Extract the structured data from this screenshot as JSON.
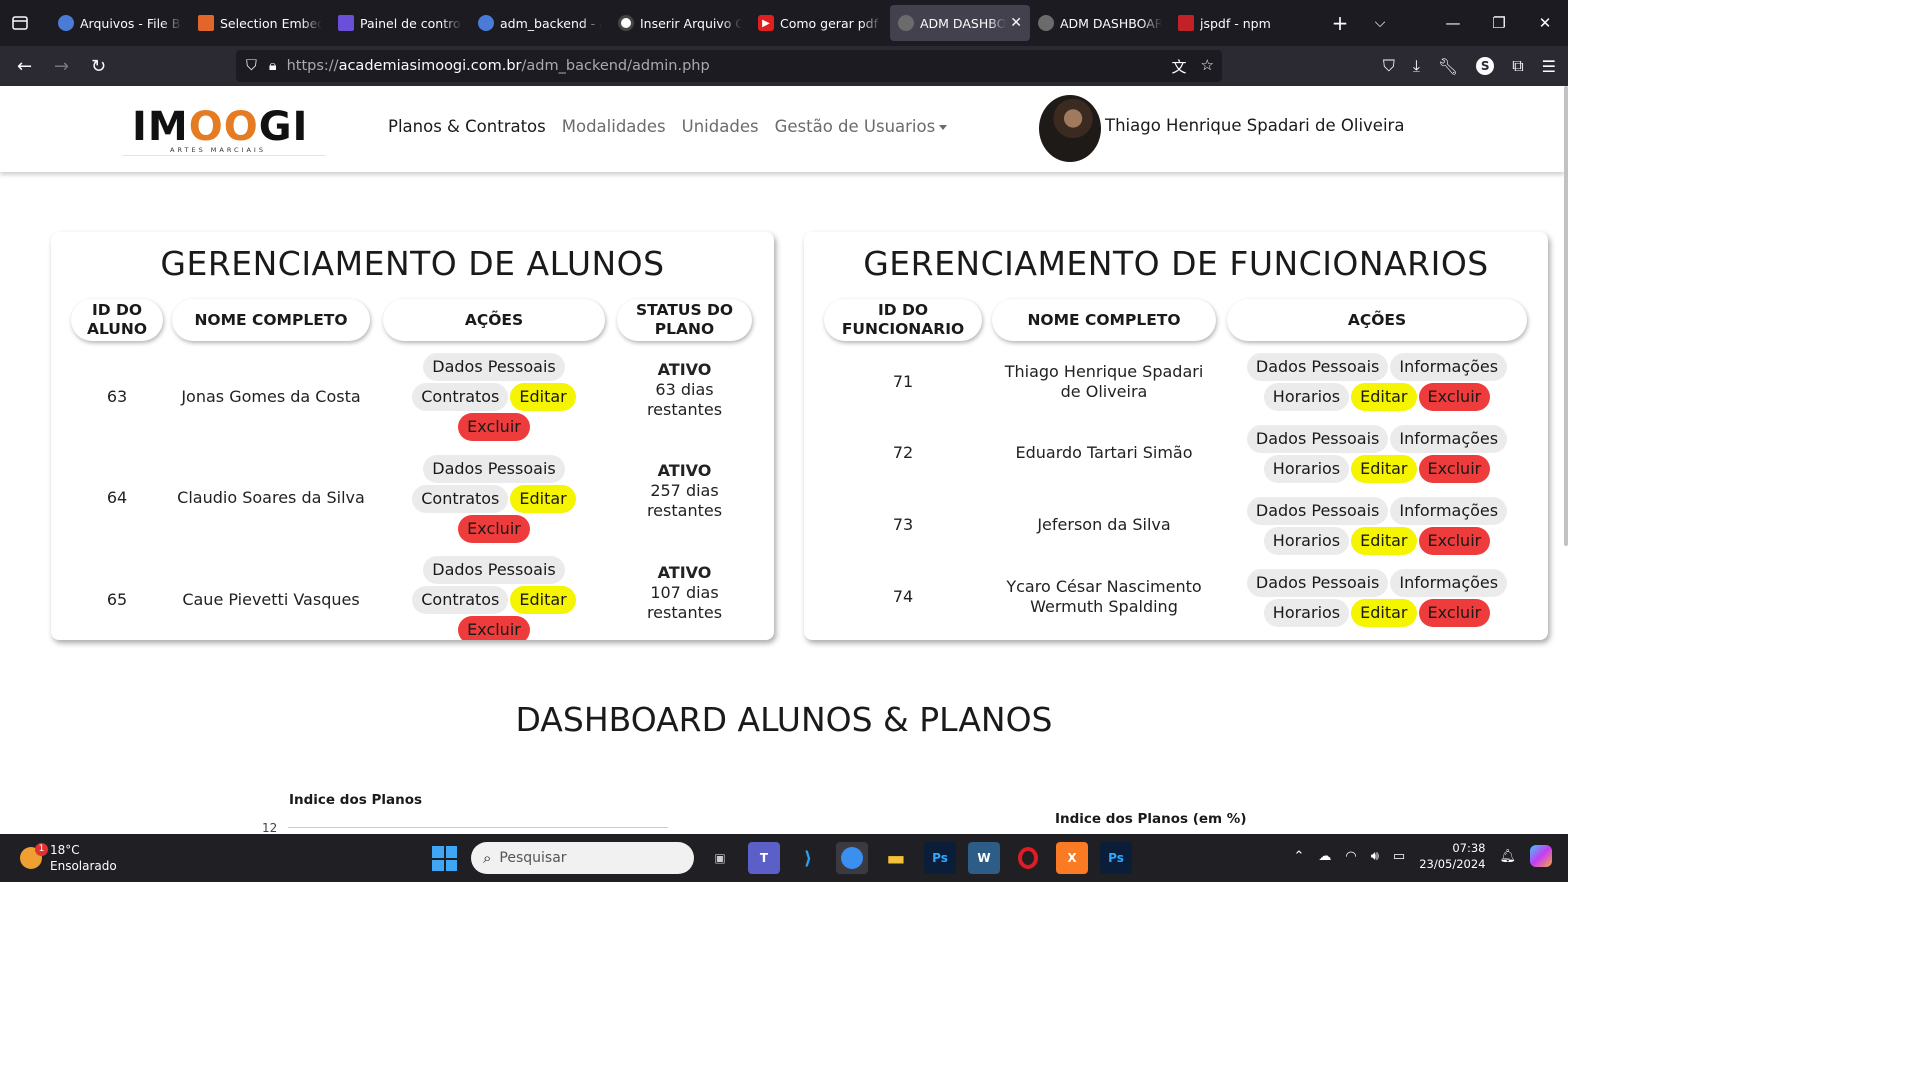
{
  "browser": {
    "tabs": [
      {
        "title": "Arquivos - File Browser",
        "color": "#4a7bd6"
      },
      {
        "title": "Selection Embed",
        "color": "#e0662c"
      },
      {
        "title": "Painel de controle",
        "color": "#6a4fd8"
      },
      {
        "title": "adm_backend - academia",
        "color": "#4a7bd6"
      },
      {
        "title": "Inserir Arquivo Gr",
        "color": "#444444"
      },
      {
        "title": "Como gerar pdf c",
        "color": "#e02020"
      },
      {
        "title": "ADM DASHBOARD",
        "color": "#6b6b6b"
      },
      {
        "title": "ADM DASHBOARD",
        "color": "#6b6b6b"
      },
      {
        "title": "jspdf - npm",
        "color": "#c12127"
      }
    ],
    "url": {
      "proto": "https://",
      "host": "academiasimoogi.com.br",
      "path": "/adm_backend/admin.php"
    }
  },
  "header": {
    "logo": {
      "brand": "IMOOGI",
      "subtitle": "ARTES MARCIAIS"
    },
    "menu": [
      "Planos & Contratos",
      "Modalidades",
      "Unidades",
      "Gestão de Usuarios"
    ],
    "user_name": "Thiago Henrique Spadari de Oliveira"
  },
  "alunos": {
    "title": "GERENCIAMENTO DE ALUNOS",
    "headers": [
      "ID DO ALUNO",
      "NOME COMPLETO",
      "AÇÕES",
      "STATUS DO PLANO"
    ],
    "actions": {
      "dados": "Dados Pessoais",
      "contratos": "Contratos",
      "editar": "Editar",
      "excluir": "Excluir"
    },
    "rows": [
      {
        "id": "63",
        "name": "Jonas Gomes da Costa",
        "status": "ATIVO",
        "remaining": "63 dias restantes"
      },
      {
        "id": "64",
        "name": "Claudio Soares da Silva",
        "status": "ATIVO",
        "remaining": "257 dias restantes"
      },
      {
        "id": "65",
        "name": "Caue Pievetti Vasques",
        "status": "ATIVO",
        "remaining": "107 dias restantes"
      }
    ]
  },
  "funcionarios": {
    "title": "GERENCIAMENTO DE FUNCIONARIOS",
    "headers": [
      "ID DO FUNCIONARIO",
      "NOME COMPLETO",
      "AÇÕES"
    ],
    "actions": {
      "dados": "Dados Pessoais",
      "info": "Informações",
      "horarios": "Horarios",
      "editar": "Editar",
      "excluir": "Excluir"
    },
    "rows": [
      {
        "id": "71",
        "name": "Thiago Henrique Spadari de Oliveira"
      },
      {
        "id": "72",
        "name": "Eduardo Tartari Simão"
      },
      {
        "id": "73",
        "name": "Jeferson da Silva"
      },
      {
        "id": "74",
        "name": "Ycaro César Nascimento Wermuth Spalding"
      }
    ]
  },
  "dashboard": {
    "title": "DASHBOARD ALUNOS & PLANOS",
    "chart1_title": "Indice dos Planos",
    "chart1_tick": "12",
    "chart2_title": "Indice dos Planos (em %)"
  },
  "taskbar": {
    "temp": "18°C",
    "weather": "Ensolarado",
    "weather_badge": "1",
    "search": "Pesquisar",
    "time": "07:38",
    "date": "23/05/2024"
  },
  "colors": {
    "yellow": "#f5f500",
    "red": "#ee3b3b",
    "gray": "#ebebeb",
    "logo_accent": "#e57b22"
  }
}
